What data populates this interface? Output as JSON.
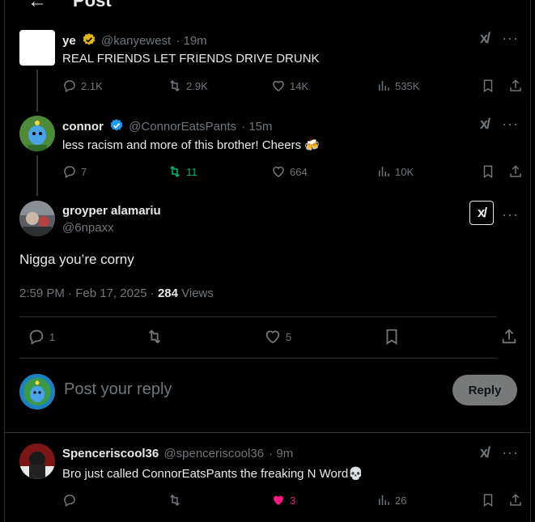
{
  "header": {
    "back": "←",
    "title": "Post"
  },
  "tweets": [
    {
      "name": "ye",
      "handle": "@kanyewest",
      "time": "· 19m",
      "text": "REAL FRIENDS LET FRIENDS DRIVE DRUNK",
      "replies": "2.1K",
      "reposts": "2.9K",
      "likes": "14K",
      "views": "535K",
      "verified_color": "#e2b719"
    },
    {
      "name": "connor",
      "handle": "@ConnorEatsPants",
      "time": "· 15m",
      "text": "less racism and more of this brother! Cheers 🍻",
      "replies": "7",
      "reposts": "11",
      "likes": "664",
      "views": "10K",
      "verified_color": "#1d9bf0",
      "repost_color": "#00ba7c"
    }
  ],
  "main": {
    "name": "groyper alamariu",
    "handle": "@6npaxx",
    "text": "Nigga you’re corny",
    "timestamp": "2:59 PM · Feb 17, 2025 · ",
    "views_count": "284",
    "views_label": " Views",
    "replies": "1",
    "likes": "5"
  },
  "reply_box": {
    "placeholder": "Post your reply",
    "button": "Reply"
  },
  "reply_tweet": {
    "name": "Spenceriscool36",
    "handle": "@spenceriscool36",
    "time": "· 9m",
    "text": "Bro just called ConnorEatsPants the freaking N Word💀",
    "likes": "3",
    "views": "26",
    "like_color": "#f91880"
  },
  "icons": {
    "grok": "grok-icon",
    "more": "more-icon"
  },
  "grok_glyph": "x/",
  "more_glyph": "···"
}
